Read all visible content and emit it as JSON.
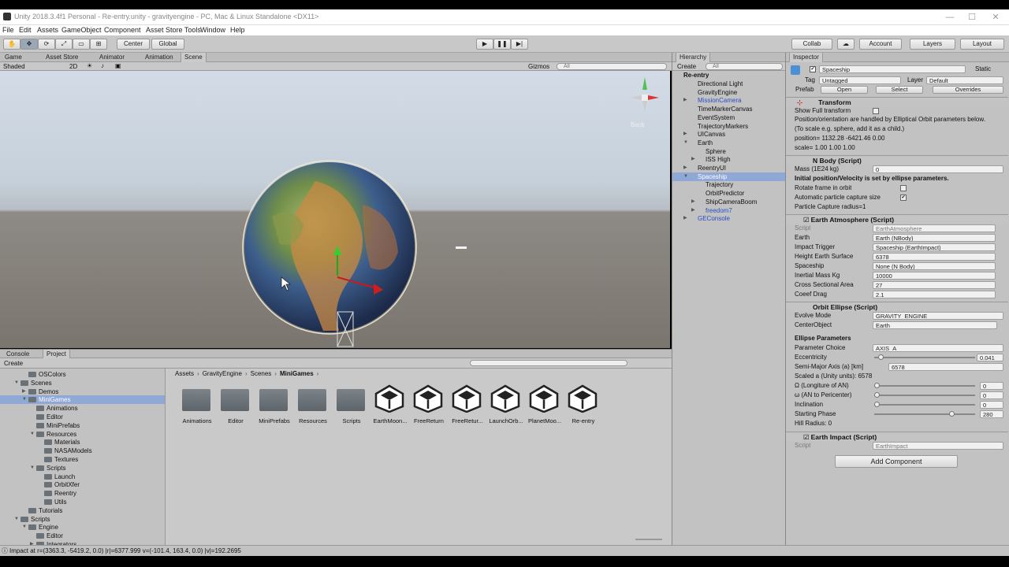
{
  "window": {
    "title": "Unity 2018.3.4f1 Personal - Re-entry.unity - gravityengine - PC, Mac & Linux Standalone <DX11>"
  },
  "menu": [
    "File",
    "Edit",
    "Assets",
    "GameObject",
    "Component",
    "Asset Store Tools",
    "Window",
    "Help"
  ],
  "toolbar": {
    "center": "Center",
    "global": "Global",
    "collab": "Collab",
    "account": "Account",
    "layers": "Layers",
    "layout": "Layout"
  },
  "scene_tabs": [
    "Game",
    "Asset Store",
    "Animator",
    "Animation",
    "Scene"
  ],
  "scene_bar": {
    "shading": "Shaded",
    "mode2d": "2D",
    "gizmos": "Gizmos",
    "search_placeholder": "All",
    "back_label": "Back"
  },
  "hierarchy": {
    "tab": "Hierarchy",
    "create": "Create",
    "search_placeholder": "All",
    "scene": "Re-entry",
    "items": [
      {
        "label": "Directional Light",
        "indent": 1,
        "blue": false,
        "arrow": ""
      },
      {
        "label": "GravityEngine",
        "indent": 1,
        "blue": false,
        "arrow": ""
      },
      {
        "label": "MissionCamera",
        "indent": 1,
        "blue": true,
        "arrow": "▶"
      },
      {
        "label": "TimeMarkerCanvas",
        "indent": 1,
        "blue": false,
        "arrow": ""
      },
      {
        "label": "EventSystem",
        "indent": 1,
        "blue": false,
        "arrow": ""
      },
      {
        "label": "TrajectoryMarkers",
        "indent": 1,
        "blue": false,
        "arrow": ""
      },
      {
        "label": "UICanvas",
        "indent": 1,
        "blue": false,
        "arrow": "▶"
      },
      {
        "label": "Earth",
        "indent": 1,
        "blue": false,
        "arrow": "▼"
      },
      {
        "label": "Sphere",
        "indent": 2,
        "blue": false,
        "arrow": ""
      },
      {
        "label": "ISS High",
        "indent": 2,
        "blue": false,
        "arrow": "▶"
      },
      {
        "label": "ReentryUI",
        "indent": 1,
        "blue": false,
        "arrow": "▶"
      },
      {
        "label": "Spaceship",
        "indent": 1,
        "blue": false,
        "arrow": "▼",
        "selected": true
      },
      {
        "label": "Trajectory",
        "indent": 2,
        "blue": false,
        "arrow": ""
      },
      {
        "label": "OrbitPredictor",
        "indent": 2,
        "blue": false,
        "arrow": ""
      },
      {
        "label": "ShipCameraBoom",
        "indent": 2,
        "blue": false,
        "arrow": "▶"
      },
      {
        "label": "freedom7",
        "indent": 2,
        "blue": true,
        "arrow": "▶"
      },
      {
        "label": "GEConsole",
        "indent": 1,
        "blue": true,
        "arrow": "▶"
      }
    ]
  },
  "inspector": {
    "tab": "Inspector",
    "object_name": "Spaceship",
    "static_label": "Static",
    "tag_label": "Tag",
    "tag_value": "Untagged",
    "layer_label": "Layer",
    "layer_value": "Default",
    "prefab_label": "Prefab",
    "open": "Open",
    "select": "Select",
    "overrides": "Overrides",
    "transform": {
      "title": "Transform",
      "show_full": "Show Full transform",
      "note1": "Position/orientation are handled by Elliptical Orbit parameters below.",
      "note2": "(To scale e.g. sphere, add it as a child.)",
      "position": "position= 1132.28 -6421.46 0.00",
      "scale": "scale= 1.00 1.00 1.00"
    },
    "nbody": {
      "title": "N Body (Script)",
      "mass_label": "Mass (1E24 kg)",
      "mass": "0",
      "init_note": "Initial position/Velocity is set by ellipse parameters.",
      "rotate": "Rotate frame in orbit",
      "auto": "Automatic particle capture size",
      "capture": "Particle Capture radius=1"
    },
    "atmos": {
      "title": "Earth Atmosphere (Script)",
      "rows": [
        {
          "label": "Script",
          "value": "EarthAtmosphere",
          "dim": true
        },
        {
          "label": "Earth",
          "value": "Earth (NBody)",
          "dim": false
        },
        {
          "label": "Impact Trigger",
          "value": "Spaceship (EarthImpact)",
          "dim": false
        },
        {
          "label": "Height Earth Surface",
          "value": "6378",
          "dim": false
        },
        {
          "label": "Spaceship",
          "value": "None (N Body)",
          "dim": false
        },
        {
          "label": "Inertial Mass Kg",
          "value": "10000",
          "dim": false
        },
        {
          "label": "Cross Sectional Area",
          "value": "27",
          "dim": false
        },
        {
          "label": "Coeef Drag",
          "value": "2.1",
          "dim": false
        }
      ]
    },
    "orbit": {
      "title": "Orbit Ellipse (Script)",
      "evolve_label": "Evolve Mode",
      "evolve_value": "GRAVITY_ENGINE",
      "center_label": "CenterObject",
      "center_value": "Earth",
      "params_header": "Ellipse Parameters",
      "param_label": "Parameter Choice",
      "param_value": "AXIS_A",
      "ecc_label": "Eccentricity",
      "ecc_value": "0.041",
      "ecc_frac": 0.041,
      "sma_label": "Semi-Major Axis (a) [km]",
      "sma_value": "6578",
      "scaled": "Scaled a (Unity units): 6578",
      "sliders": [
        {
          "label": "Ω (Longiture of AN)",
          "value": "0",
          "frac": 0
        },
        {
          "label": "ω (AN to Pericenter)",
          "value": "0",
          "frac": 0
        },
        {
          "label": "Inclination",
          "value": "0",
          "frac": 0
        },
        {
          "label": "Starting Phase",
          "value": "280",
          "frac": 0.778
        }
      ],
      "hill": "Hill Radius: 0"
    },
    "impact": {
      "title": "Earth Impact (Script)",
      "script_label": "Script",
      "script_value": "EarthImpact"
    },
    "add_component": "Add Component"
  },
  "bottom": {
    "tabs": [
      "Console",
      "Project"
    ],
    "create": "Create",
    "breadcrumb": [
      "Assets",
      "GravityEngine",
      "Scenes",
      "MiniGames"
    ],
    "tree": [
      {
        "label": "OSColors",
        "indent": 3,
        "arrow": ""
      },
      {
        "label": "Scenes",
        "indent": 2,
        "arrow": "▼"
      },
      {
        "label": "Demos",
        "indent": 3,
        "arrow": "▶"
      },
      {
        "label": "MiniGames",
        "indent": 3,
        "arrow": "▼",
        "selected": true
      },
      {
        "label": "Animations",
        "indent": 4,
        "arrow": ""
      },
      {
        "label": "Editor",
        "indent": 4,
        "arrow": ""
      },
      {
        "label": "MiniPrefabs",
        "indent": 4,
        "arrow": ""
      },
      {
        "label": "Resources",
        "indent": 4,
        "arrow": "▼"
      },
      {
        "label": "Materials",
        "indent": 5,
        "arrow": ""
      },
      {
        "label": "NASAModels",
        "indent": 5,
        "arrow": ""
      },
      {
        "label": "Textures",
        "indent": 5,
        "arrow": ""
      },
      {
        "label": "Scripts",
        "indent": 4,
        "arrow": "▼"
      },
      {
        "label": "Launch",
        "indent": 5,
        "arrow": ""
      },
      {
        "label": "OrbitXfer",
        "indent": 5,
        "arrow": ""
      },
      {
        "label": "Reentry",
        "indent": 5,
        "arrow": ""
      },
      {
        "label": "Utils",
        "indent": 5,
        "arrow": ""
      },
      {
        "label": "Tutorials",
        "indent": 3,
        "arrow": ""
      },
      {
        "label": "Scripts",
        "indent": 2,
        "arrow": "▼"
      },
      {
        "label": "Engine",
        "indent": 3,
        "arrow": "▼"
      },
      {
        "label": "Editor",
        "indent": 4,
        "arrow": ""
      },
      {
        "label": "Integrators",
        "indent": 4,
        "arrow": "▶"
      }
    ],
    "assets": [
      {
        "label": "Animations",
        "kind": "folder"
      },
      {
        "label": "Editor",
        "kind": "folder"
      },
      {
        "label": "MiniPrefabs",
        "kind": "folder"
      },
      {
        "label": "Resources",
        "kind": "folder"
      },
      {
        "label": "Scripts",
        "kind": "folder"
      },
      {
        "label": "EarthMoon...",
        "kind": "unity"
      },
      {
        "label": "FreeReturn",
        "kind": "unity"
      },
      {
        "label": "FreeRetur...",
        "kind": "unity"
      },
      {
        "label": "LaunchOrb...",
        "kind": "unity"
      },
      {
        "label": "PlanetMoo...",
        "kind": "unity"
      },
      {
        "label": "Re-entry",
        "kind": "unity"
      }
    ]
  },
  "status": "Impact at r=(3363.3, -5419.2, 0.0) |r|=6377.999 v=(-101.4, 163.4, 0.0)  |v|=192.2695"
}
